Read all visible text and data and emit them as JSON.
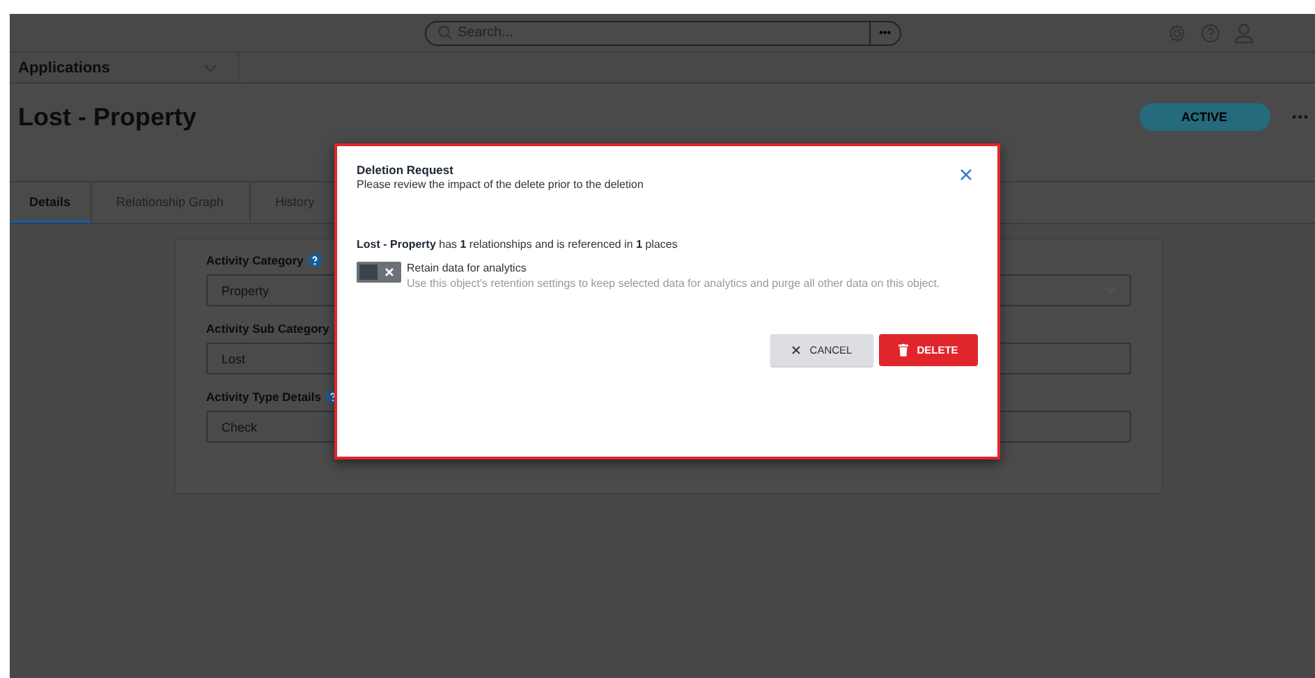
{
  "topbar": {
    "search": {
      "placeholder": "Search..."
    },
    "search_more": "•••"
  },
  "app_menu": {
    "label": "Applications"
  },
  "record": {
    "title": "Lost - Property",
    "status": "ACTIVE",
    "more": "•••"
  },
  "tabs": [
    {
      "label": "Details",
      "selected": true
    },
    {
      "label": "Relationship Graph",
      "selected": false
    },
    {
      "label": "History",
      "selected": false
    }
  ],
  "fields": [
    {
      "label": "Activity Category",
      "help": true,
      "kind": "select",
      "value": "Property"
    },
    {
      "label": "Activity Sub Category",
      "help": false,
      "kind": "text",
      "value": "Lost"
    },
    {
      "label": "Activity Type Details",
      "help": true,
      "kind": "text",
      "value": "Check"
    }
  ],
  "dialog": {
    "title": "Deletion Request",
    "subtitle": "Please review the impact of the delete prior to the deletion",
    "message": "**Lost - Property** has **1** relationships and is referenced in **1** places",
    "toggle": {
      "checked": false,
      "label": "Retain data for analytics",
      "description": "Use this object's retention settings to keep selected data for analytics and purge all other data on this object."
    },
    "buttons": [
      {
        "kind": "cancel",
        "label": "CANCEL"
      },
      {
        "kind": "delete",
        "label": "DELETE"
      }
    ]
  }
}
